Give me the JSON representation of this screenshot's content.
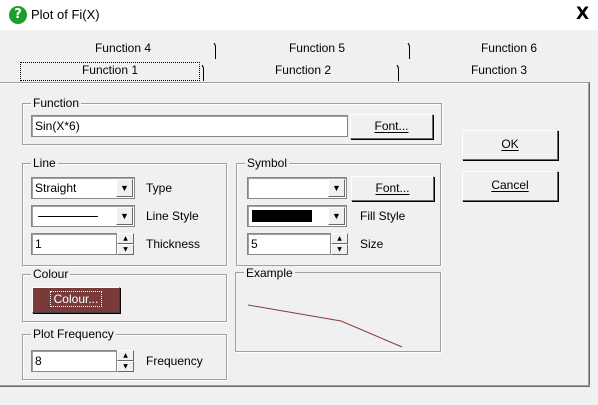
{
  "window": {
    "title": "Plot of Fi(X)",
    "close_glyph": "X",
    "icon": "help-icon"
  },
  "tabs": {
    "back_row": [
      "Function 4",
      "Function 5",
      "Function 6"
    ],
    "front_row": [
      "Function 1",
      "Function 2",
      "Function 3"
    ],
    "selected": "Function 1"
  },
  "function_group": {
    "label": "Function",
    "value": "Sin(X*6)",
    "font_button": "Font..."
  },
  "line_group": {
    "label": "Line",
    "type_value": "Straight",
    "type_label": "Type",
    "style_label": "Line Style",
    "thickness_value": "1",
    "thickness_label": "Thickness"
  },
  "symbol_group": {
    "label": "Symbol",
    "symbol_value": "",
    "font_button": "Font...",
    "fill_style_label": "Fill Style",
    "size_value": "5",
    "size_label": "Size"
  },
  "colour_group": {
    "label": "Colour",
    "button": "Colour...",
    "color": "#7b3a3a"
  },
  "frequency_group": {
    "label": "Plot Frequency",
    "value": "8",
    "frequency_label": "Frequency"
  },
  "example_group": {
    "label": "Example",
    "line_color": "#8b3a3a"
  },
  "buttons": {
    "ok": "OK",
    "cancel": "Cancel"
  }
}
